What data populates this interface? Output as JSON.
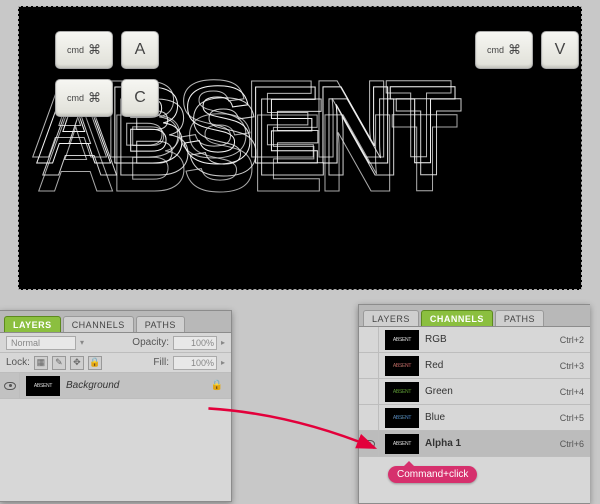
{
  "keys": {
    "cmd": "cmd",
    "cmd_symbol": "⌘",
    "a": "A",
    "c": "C",
    "v": "V"
  },
  "layers_panel": {
    "tabs": [
      "LAYERS",
      "CHANNELS",
      "PATHS"
    ],
    "active_tab": 0,
    "blend_mode": "Normal",
    "opacity_label": "Opacity:",
    "opacity_value": "100%",
    "lock_label": "Lock:",
    "fill_label": "Fill:",
    "fill_value": "100%",
    "layer": {
      "name": "Background",
      "visible": true
    }
  },
  "channels_panel": {
    "tabs": [
      "LAYERS",
      "CHANNELS",
      "PATHS"
    ],
    "active_tab": 1,
    "channels": [
      {
        "name": "RGB",
        "shortcut": "Ctrl+2",
        "visible": false,
        "selected": false,
        "tint": ""
      },
      {
        "name": "Red",
        "shortcut": "Ctrl+3",
        "visible": false,
        "selected": false,
        "tint": "red"
      },
      {
        "name": "Green",
        "shortcut": "Ctrl+4",
        "visible": false,
        "selected": false,
        "tint": "green"
      },
      {
        "name": "Blue",
        "shortcut": "Ctrl+5",
        "visible": false,
        "selected": false,
        "tint": "blue"
      },
      {
        "name": "Alpha 1",
        "shortcut": "Ctrl+6",
        "visible": true,
        "selected": true,
        "tint": ""
      }
    ]
  },
  "callout": "Command+click",
  "artwork_text": "ABSENT"
}
